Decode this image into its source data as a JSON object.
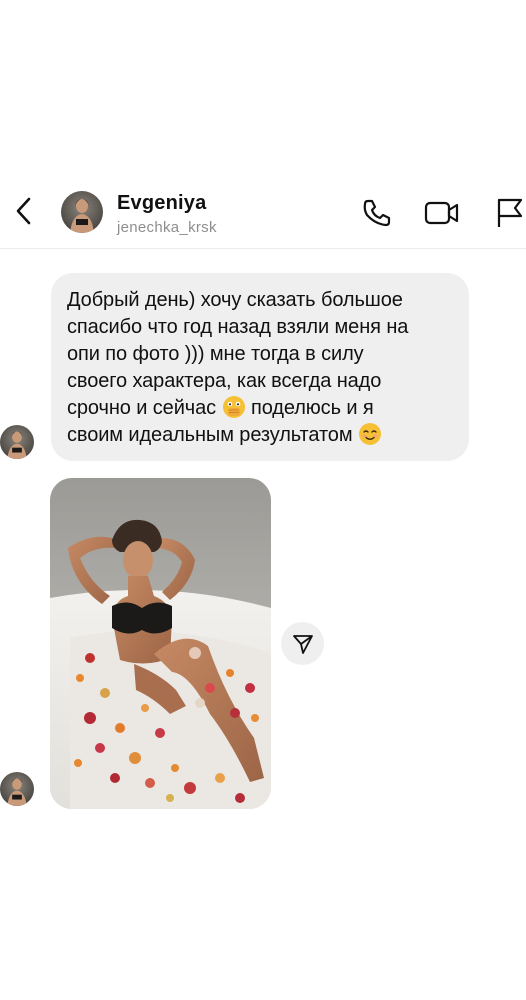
{
  "header": {
    "name": "Evgeniya",
    "username": "jenechka_krsk",
    "icons": {
      "back": "chevron-left-icon",
      "call": "phone-icon",
      "video": "video-camera-icon",
      "report": "flag-icon"
    }
  },
  "messages": [
    {
      "type": "text",
      "lines": [
        "Добрый день) хочу сказать большое",
        "спасибо что год назад взяли меня на",
        "опи по фото ))) мне  тогда в силу",
        "своего характера, как всегда надо",
        "срочно и сейчас",
        "поделюсь и я",
        "своим идеальным результатом"
      ],
      "emojis": [
        "face-with-open-eyes-and-hand-over-mouth",
        "smiling-face"
      ]
    },
    {
      "type": "photo",
      "description_icon": "share-send-icon"
    }
  ],
  "colors": {
    "bubble": "#efefef",
    "secondary_text": "#8e8e8e",
    "accent_emoji": "#f5c033"
  }
}
